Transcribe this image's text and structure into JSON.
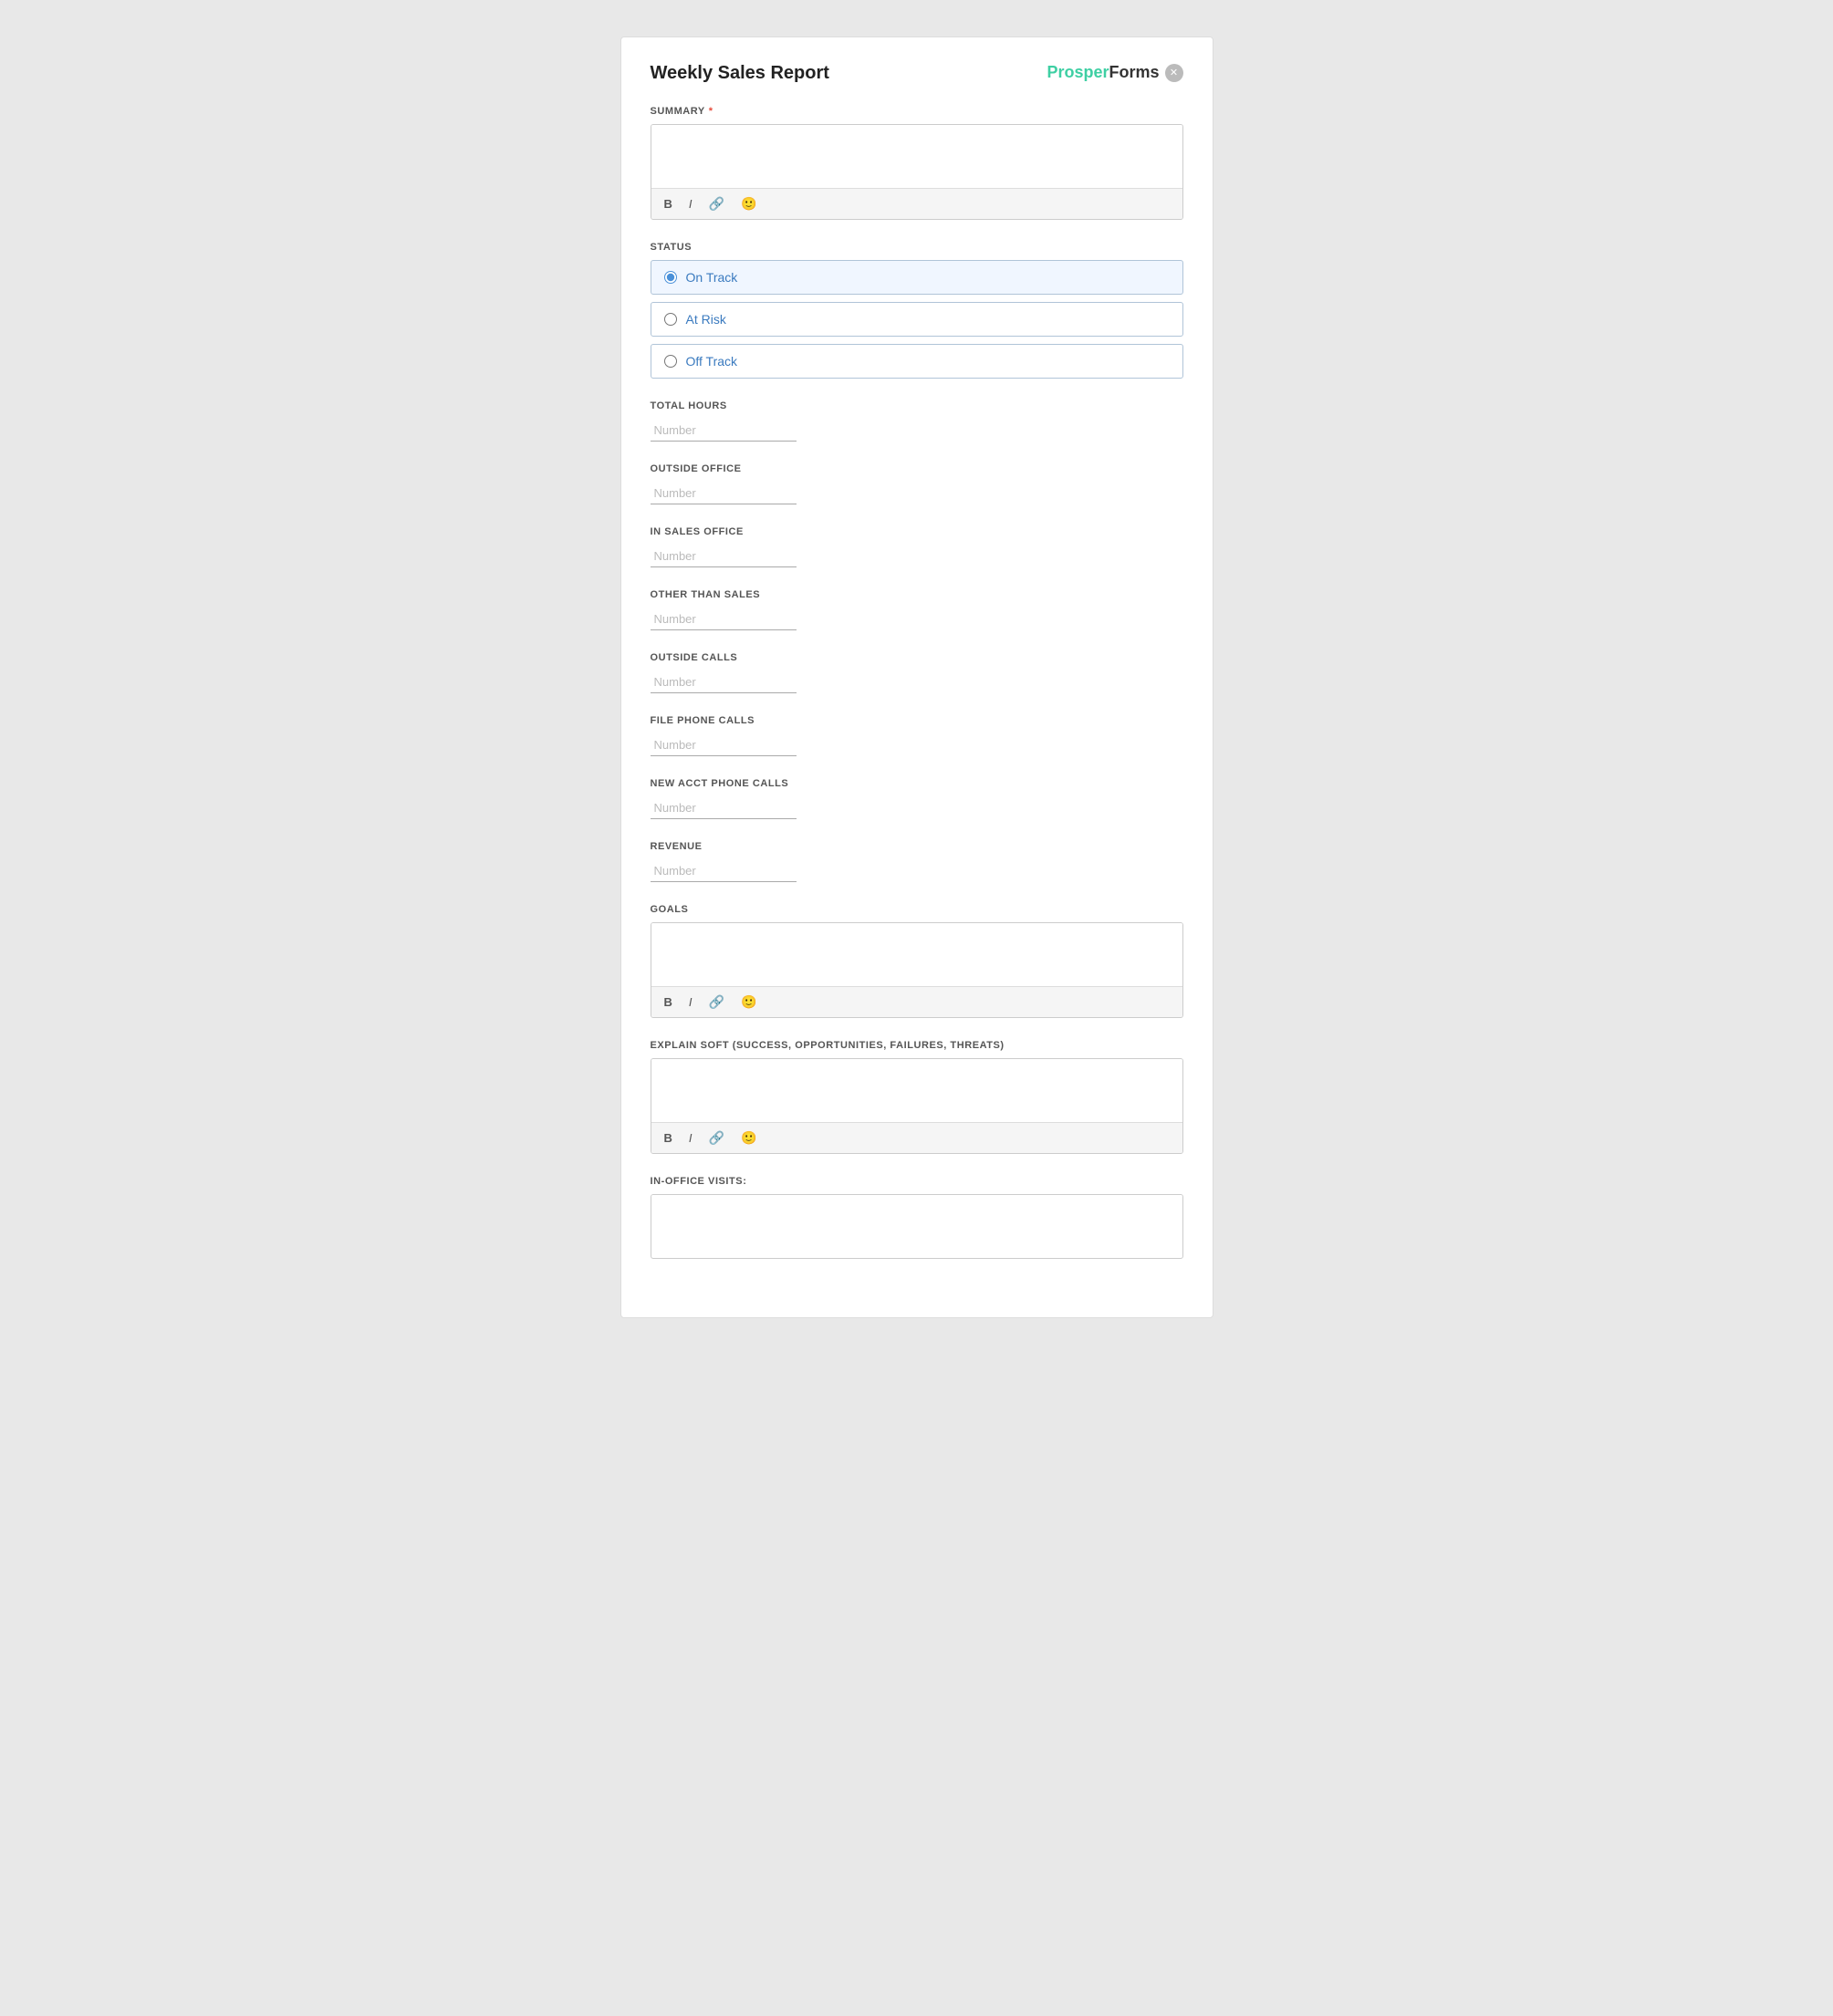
{
  "header": {
    "title": "Weekly Sales Report",
    "logo_prosper": "Prosper",
    "logo_forms": "Forms"
  },
  "sections": {
    "summary": {
      "label": "SUMMARY",
      "required": true,
      "placeholder": ""
    },
    "status": {
      "label": "STATUS",
      "options": [
        {
          "id": "on-track",
          "label": "On Track",
          "selected": true
        },
        {
          "id": "at-risk",
          "label": "At Risk",
          "selected": false
        },
        {
          "id": "off-track",
          "label": "Off Track",
          "selected": false
        }
      ]
    },
    "total_hours": {
      "label": "TOTAL HOURS",
      "placeholder": "Number"
    },
    "outside_office": {
      "label": "OUTSIDE OFFICE",
      "placeholder": "Number"
    },
    "in_sales_office": {
      "label": "IN SALES OFFICE",
      "placeholder": "Number"
    },
    "other_than_sales": {
      "label": "OTHER THAN SALES",
      "placeholder": "Number"
    },
    "outside_calls": {
      "label": "OUTSIDE CALLS",
      "placeholder": "Number"
    },
    "file_phone_calls": {
      "label": "FILE PHONE CALLS",
      "placeholder": "Number"
    },
    "new_acct_phone_calls": {
      "label": "NEW ACCT PHONE CALLS",
      "placeholder": "Number"
    },
    "revenue": {
      "label": "REVENUE",
      "placeholder": "Number"
    },
    "goals": {
      "label": "GOALS",
      "placeholder": ""
    },
    "explain_soft": {
      "label": "EXPLAIN SOFT (SUCCESS, OPPORTUNITIES, FAILURES, THREATS)",
      "placeholder": ""
    },
    "in_office_visits": {
      "label": "IN-OFFICE VISITS:",
      "placeholder": ""
    }
  },
  "toolbar": {
    "bold": "B",
    "italic": "I",
    "link": "🔗",
    "emoji": "🙂"
  }
}
